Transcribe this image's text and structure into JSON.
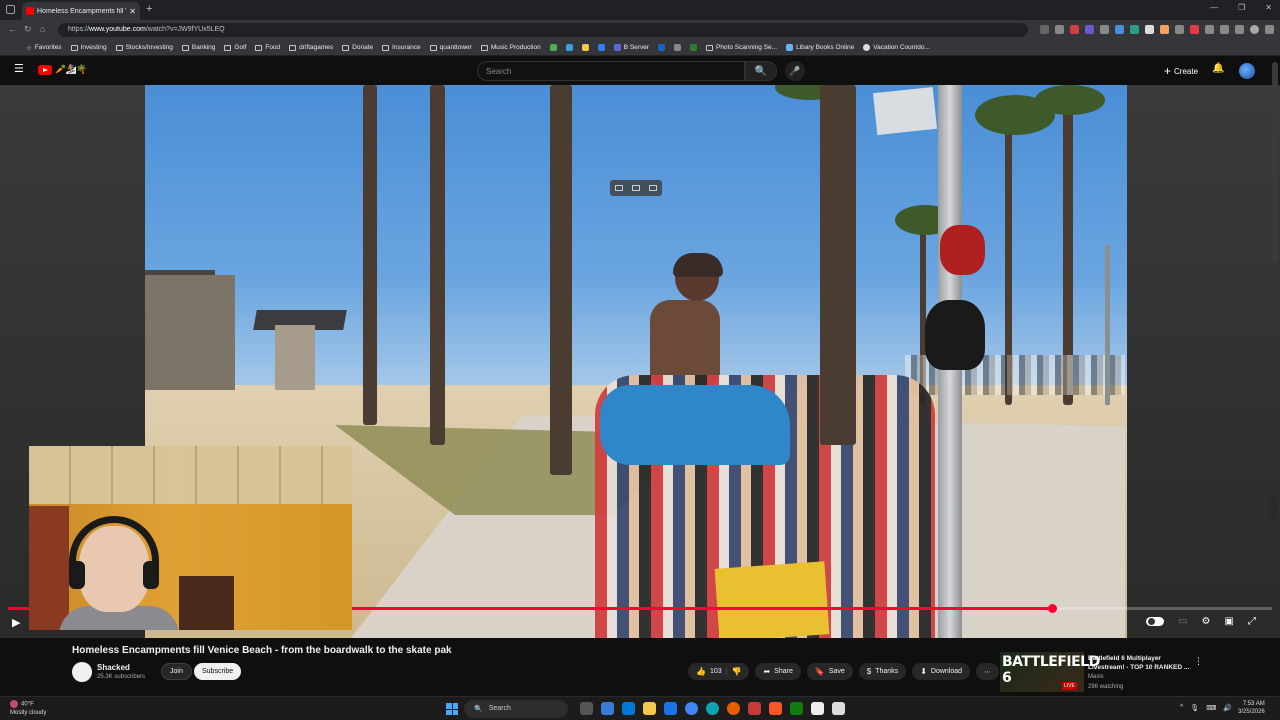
{
  "browser": {
    "tab_title": "Homeless Encampments fill Ve",
    "url_prefix": "https://",
    "url_domain": "www.youtube.com",
    "url_path": "/watch?v=JW9fYUx5LEQ",
    "bookmarks": [
      "Favorites",
      "Investing",
      "Stocks/Investing",
      "Banking",
      "Golf",
      "Food",
      "driftagames",
      "Donate",
      "Insurance",
      "quanttower",
      "Music Production",
      "B Server",
      "Photo Scanning Se...",
      "Libary Books Online",
      "Vacation Countdo..."
    ]
  },
  "youtube": {
    "search_placeholder": "Search",
    "create_label": "Create",
    "logo_suffix": "🥕🏂🌴"
  },
  "video": {
    "title": "Homeless Encampments fill Venice Beach - from the boardwalk to the skate pak",
    "progress_fraction": 0.826
  },
  "channel": {
    "name": "Shacked",
    "subscribers": "25.3K subscribers",
    "join_label": "Join",
    "subscribe_label": "Subscribe"
  },
  "actions": {
    "likes": "103",
    "share": "Share",
    "save": "Save",
    "thanks": "Thanks",
    "download": "Download"
  },
  "recommended": {
    "thumb_text": "BATTLEFIELD 6",
    "live_badge": "LIVE",
    "title": "Battlefield 6 Multiplayer Livestream! - TOP 10 RANKED ...",
    "channel": "Maxis",
    "watching": "286 watching"
  },
  "taskbar": {
    "temp": "40°F",
    "weather": "Mostly cloudy",
    "search": "Search",
    "time": "7:53 AM",
    "date": "3/25/2026"
  },
  "colors": {
    "yt_red": "#ff0000",
    "progress": "#ff0033",
    "bg": "#0f0f0f"
  }
}
